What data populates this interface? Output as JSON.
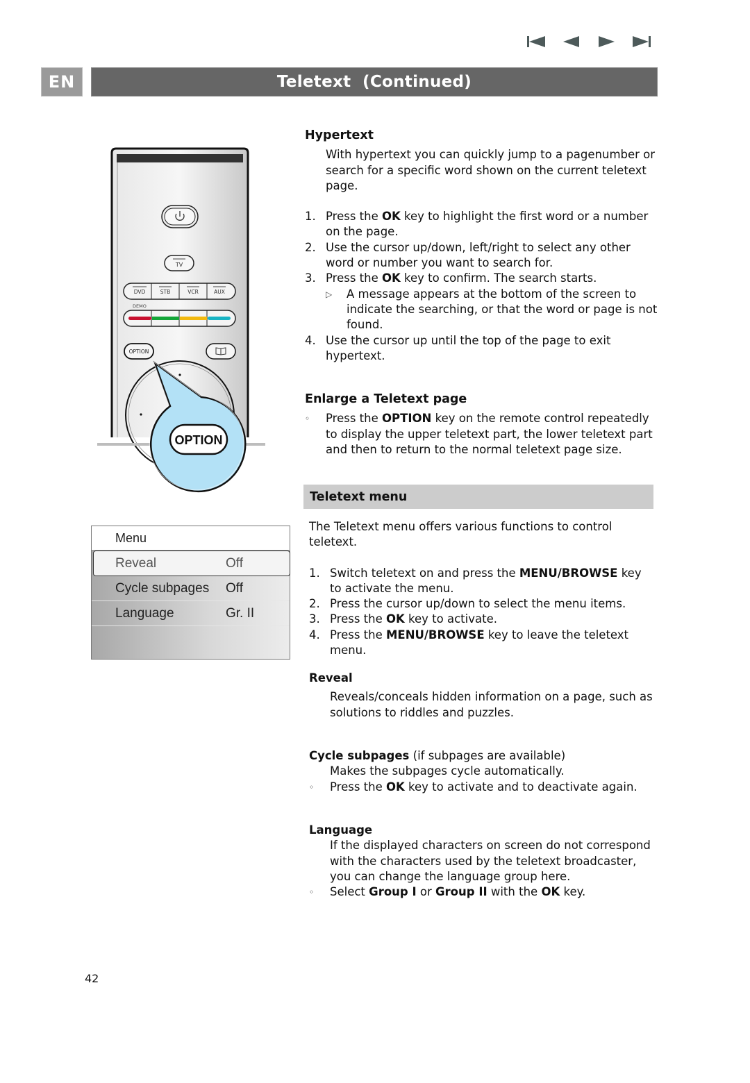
{
  "nav": {
    "first": "skip-to-first-icon",
    "prev": "previous-icon",
    "next": "next-icon",
    "last": "skip-to-last-icon"
  },
  "header": {
    "language_badge": "EN",
    "title": "Teletext  (Continued)"
  },
  "remote": {
    "power_icon": "power-icon",
    "tv_label": "TV",
    "source_buttons": [
      "DVD",
      "STB",
      "VCR",
      "AUX"
    ],
    "demo_label": "DEMO",
    "color_keys": [
      "#c8102e",
      "#13a538",
      "#f2b90f",
      "#18b4c4"
    ],
    "option_small_label": "OPTION",
    "book_icon": "book-icon",
    "option_callout_label": "OPTION",
    "callout_color": "#b3e1f6"
  },
  "menu_widget": {
    "title": "Menu",
    "items": [
      {
        "label": "Reveal",
        "value": "Off",
        "selected": true
      },
      {
        "label": "Cycle subpages",
        "value": "Off",
        "selected": false
      },
      {
        "label": "Language",
        "value": "Gr. II",
        "selected": false
      }
    ]
  },
  "hypertext": {
    "heading": "Hypertext",
    "intro": "With hypertext you can quickly jump to a pagenumber or search for a specific word shown on the current teletext page.",
    "steps": [
      {
        "num": "1.",
        "pre": "Press the ",
        "bold": "OK",
        "post": " key to highlight the first word or a number on the page."
      },
      {
        "num": "2.",
        "text": "Use the cursor up/down, left/right to select any other word or number you want to search for."
      },
      {
        "num": "3.",
        "pre": "Press the ",
        "bold": "OK",
        "post": " key to confirm. The search starts."
      },
      {
        "num": "4.",
        "text": "Use the cursor up until the top of the page to exit hypertext."
      }
    ],
    "sub_note": "A message appears at the bottom of the screen to indicate the searching, or that the word or page is not found."
  },
  "enlarge": {
    "heading": "Enlarge a Teletext page",
    "pre": "Press the ",
    "bold": "OPTION",
    "post": " key on the remote control repeatedly to display the upper teletext part, the lower teletext part and then to return to the normal teletext page size."
  },
  "teletext_menu": {
    "heading": "Teletext menu",
    "intro": "The Teletext menu offers various functions to control teletext.",
    "steps": [
      {
        "num": "1.",
        "pre": "Switch teletext on and press the ",
        "bold": "MENU/BROWSE",
        "post": " key to activate the menu."
      },
      {
        "num": "2.",
        "pre": "Press the cursor up/down to select the menu items.",
        "bold": "",
        "post": ""
      },
      {
        "num": "3.",
        "pre": "Press the ",
        "bold": "OK",
        "post": " key to activate."
      },
      {
        "num": "4.",
        "pre": "Press the ",
        "bold": "MENU/BROWSE",
        "post": " key to leave the teletext menu."
      }
    ]
  },
  "reveal": {
    "heading": "Reveal",
    "text": "Reveals/conceals hidden information on a page, such as solutions to riddles and puzzles."
  },
  "cycle": {
    "heading": "Cycle subpages",
    "heading_note": " (if subpages are available)",
    "text": "Makes the subpages cycle automatically.",
    "bullet_pre": "Press the ",
    "bullet_bold": "OK",
    "bullet_post": " key to activate and to deactivate again."
  },
  "language": {
    "heading": "Language",
    "text": "If the displayed characters on screen do not correspond with the characters used by the teletext broadcaster, you can change the language group here.",
    "b_pre": "Select ",
    "b_bold1": "Group I",
    "b_mid": " or ",
    "b_bold2": "Group II",
    "b_mid2": " with the ",
    "b_bold3": "OK",
    "b_post": " key."
  },
  "footer": {
    "page_number": "42"
  }
}
